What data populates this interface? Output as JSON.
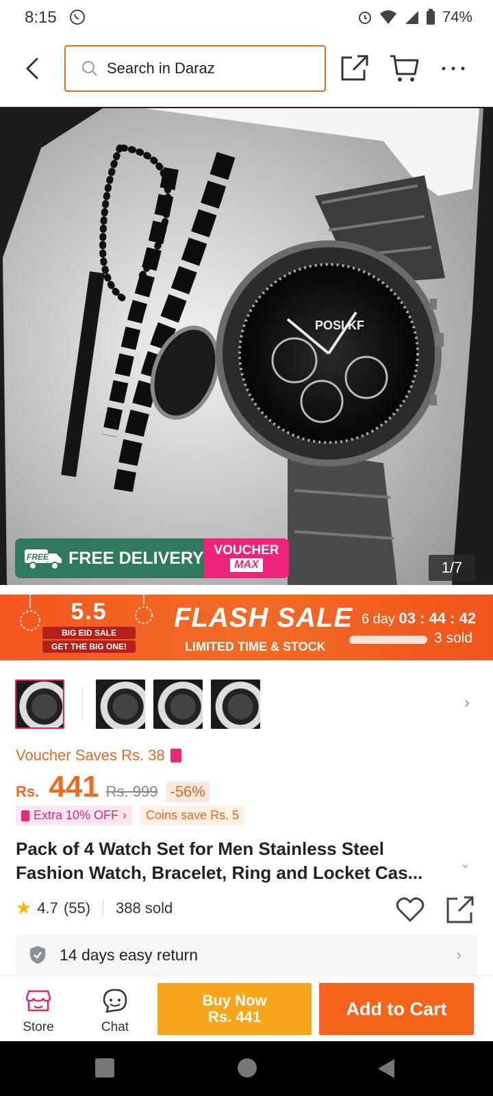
{
  "status_bar": {
    "time": "8:15",
    "battery": "74%"
  },
  "header": {
    "search_placeholder": "Search in Daraz"
  },
  "hero": {
    "free_delivery": "FREE DELIVERY",
    "free_tag": "FREE",
    "voucher": "VOUCHER",
    "voucher_max": "MAX",
    "counter": "1/7",
    "watch_brand": "POSI KF"
  },
  "flash": {
    "big": "5.5",
    "eid_small1": "BIG EID SALE",
    "eid_small2": "GET THE BIG ONE!",
    "title": "FLASH SALE",
    "subtitle": "LIMITED TIME & STOCK",
    "days": "6 day",
    "clock": "03 : 44 : 42",
    "sold": "3 sold",
    "sold_progress": 1.0
  },
  "price": {
    "voucher_saves": "Voucher Saves Rs. 38",
    "currency": "Rs.",
    "value": "441",
    "old": "Rs. 999",
    "discount": "-56%",
    "extra_off": "Extra 10% OFF",
    "coins": "Coins save Rs. 5"
  },
  "product": {
    "title": "Pack of 4 Watch Set for Men Stainless Steel Fashion Watch, Bracelet, Ring and Locket Cas...",
    "rating": "4.7",
    "reviews": "(55)",
    "sold": "388 sold",
    "return_policy": "14 days easy return"
  },
  "bottom": {
    "store": "Store",
    "chat": "Chat",
    "buy_now": "Buy Now",
    "buy_price": "Rs. 441",
    "add_to_cart": "Add to Cart"
  },
  "colors": {
    "accent": "#f5641a",
    "buy_now": "#f7a51b",
    "pink": "#f0237a",
    "delivery_green": "#2f7a5c"
  }
}
